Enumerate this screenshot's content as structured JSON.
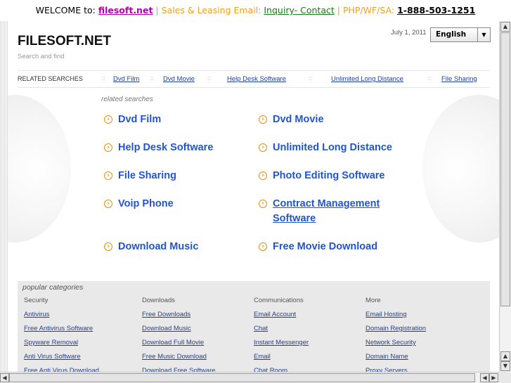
{
  "welcome": {
    "prefix": "WELCOME to:",
    "domain": "filesoft.net",
    "sep1": "|",
    "sales": "Sales & Leasing Email:",
    "inquiry": "Inquiry- Contact",
    "sep2": "|",
    "php": "PHP/WF/SA:",
    "phone": "1-888-503-1251"
  },
  "header": {
    "site_title": "FILESOFT.NET",
    "tagline": "Search and find",
    "date": "July 1, 2011",
    "language": "English"
  },
  "related_bar": {
    "label": "RELATED SEARCHES",
    "sep": "::",
    "links": [
      "Dvd Film",
      "Dvd Movie",
      "Help Desk Software",
      "Unlimited Long Distance",
      "File Sharing"
    ]
  },
  "related_searches": {
    "heading": "related searches",
    "links": [
      "Dvd Film",
      "Dvd Movie",
      "Help Desk Software",
      "Unlimited Long Distance",
      "File Sharing",
      "Photo Editing Software",
      "Voip Phone",
      "Contract Management Software",
      "Download Music",
      "Free Movie Download"
    ]
  },
  "popular": {
    "heading": "popular categories",
    "columns": [
      {
        "title": "Security",
        "links": [
          "Antivirus",
          "Free Antivirus Software",
          "Spyware Removal",
          "Anti Virus Software",
          "Free Anti Virus Download"
        ]
      },
      {
        "title": "Downloads",
        "links": [
          "Free Downloads",
          "Download Music",
          "Download Full Movie",
          "Free Music Download",
          "Download Free Software"
        ]
      },
      {
        "title": "Communications",
        "links": [
          "Email Account",
          "Chat",
          "Instant Messenger",
          "Email",
          "Chat Room"
        ]
      },
      {
        "title": "More",
        "links": [
          "Email Hosting",
          "Domain Registration",
          "Network Security",
          "Domain Name",
          "Proxy Servers"
        ]
      }
    ]
  },
  "icons": {
    "bullet": "arrow-circle-icon",
    "scroll_up": "triangle-up-icon",
    "scroll_down": "triangle-down-icon",
    "scroll_left": "triangle-left-icon",
    "scroll_right": "triangle-right-icon"
  },
  "colors": {
    "link": "#2255cc",
    "accent": "#e8900c",
    "brand_magenta": "#b000b0"
  }
}
